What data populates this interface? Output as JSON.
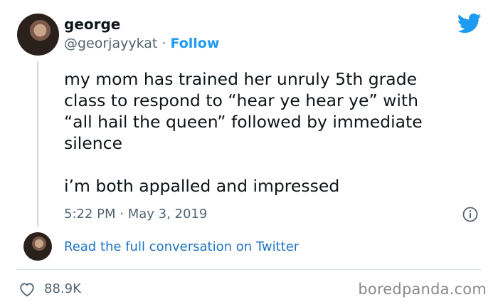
{
  "user": {
    "name": "george",
    "handle": "@georjayykat",
    "separator": "·",
    "follow_label": "Follow"
  },
  "tweet": {
    "line1": "my mom has trained her unruly 5th grade",
    "line2": "class to respond to “hear ye hear ye” with",
    "line3": "“all hail the queen” followed by immediate",
    "line4": "silence",
    "line5": "i’m both appalled and impressed",
    "timestamp": "5:22 PM · May 3, 2019"
  },
  "conversation_link": "Read the full conversation on Twitter",
  "likes_count": "88.9K",
  "watermark": "boredpanda.com",
  "icons": {
    "brand": "twitter-bird-icon",
    "info": "info-icon",
    "like": "heart-icon"
  },
  "colors": {
    "accent": "#1d9bf0",
    "link": "#1d74c4",
    "secondary_text": "#536471",
    "divider": "#cfd9de"
  }
}
